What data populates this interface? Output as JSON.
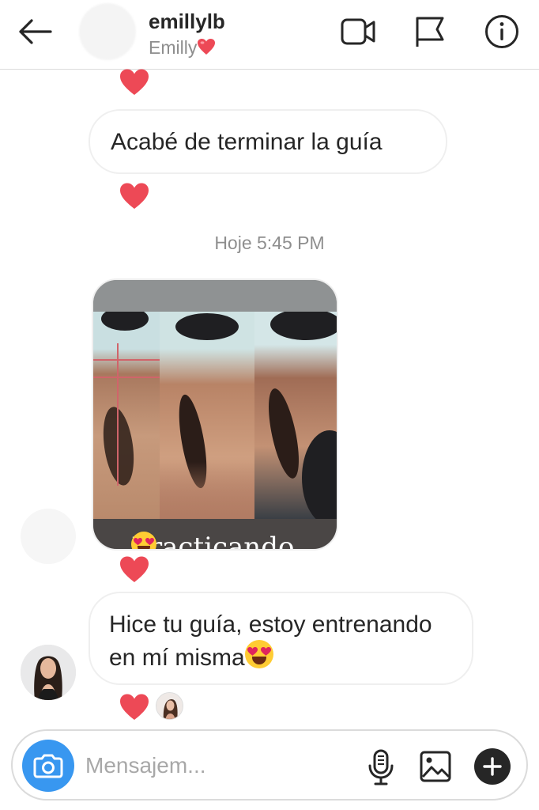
{
  "header": {
    "username": "emillylb",
    "display_name": "Emilly",
    "back_icon": "arrow-left-icon",
    "icons": [
      "video-camera-icon",
      "flag-icon",
      "info-icon"
    ]
  },
  "messages": [
    {
      "type": "text",
      "text": "Acabé de terminar la guía",
      "reaction": "heart"
    },
    {
      "type": "timestamp",
      "text": "Hoje 5:45 PM"
    },
    {
      "type": "image",
      "caption": "Practicando",
      "caption_emoji": "heart-eyes-emoji",
      "reaction": "heart"
    },
    {
      "type": "text",
      "text_line1": "Hice tu guía, estoy entrenando",
      "text_line2": "en mí misma",
      "emoji": "heart-eyes-emoji",
      "reaction": "heart"
    }
  ],
  "composer": {
    "placeholder": "Mensajem...",
    "icons": [
      "camera-icon",
      "microphone-icon",
      "gallery-icon",
      "plus-icon"
    ]
  },
  "colors": {
    "heart": "#ed4956",
    "camera_button": "#3897f0",
    "secondary_text": "#8e8e8e",
    "border": "#dbdbdb"
  }
}
